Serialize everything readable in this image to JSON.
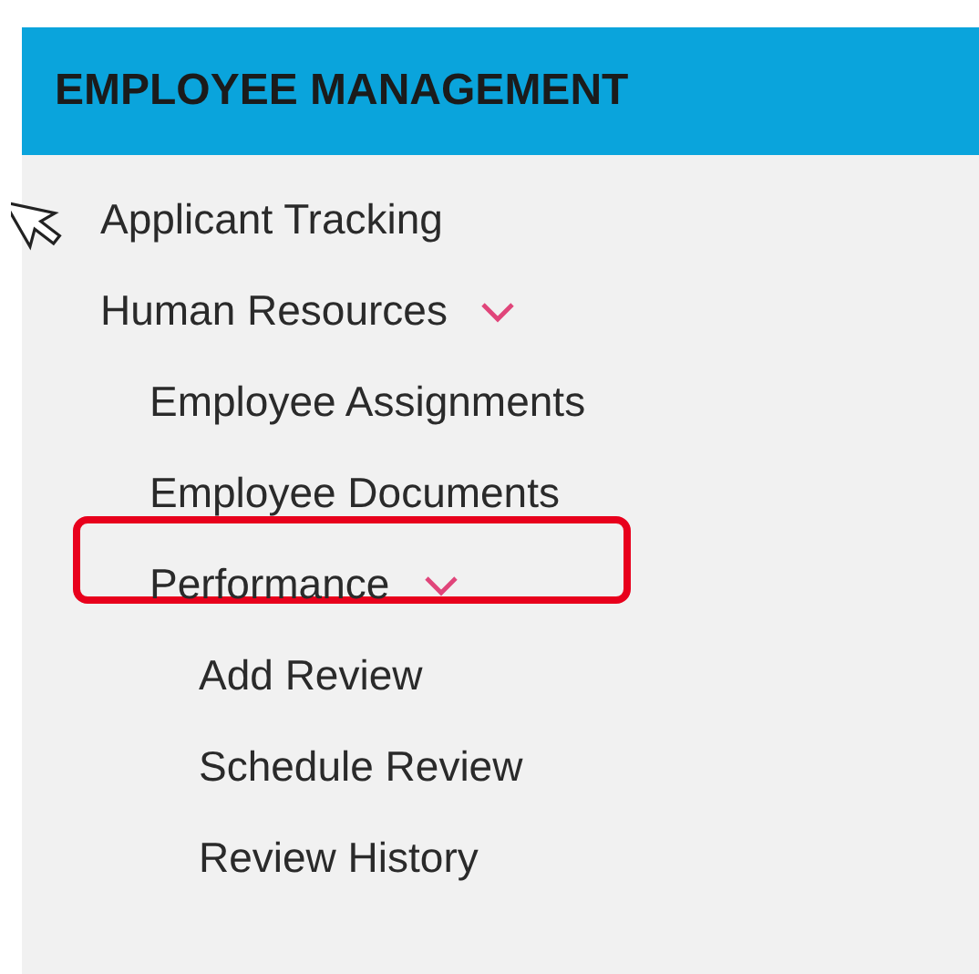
{
  "sidebar": {
    "title": "EMPLOYEE MANAGEMENT",
    "items": [
      {
        "label": "Applicant Tracking",
        "highlighted": false
      },
      {
        "label": "Human Resources",
        "expanded": true,
        "highlighted": false,
        "children": [
          {
            "label": "Employee Assignments",
            "highlighted": false
          },
          {
            "label": "Employee Documents",
            "highlighted": false
          },
          {
            "label": "Performance",
            "expanded": true,
            "highlighted": true,
            "children": [
              {
                "label": "Add Review",
                "highlighted": false
              },
              {
                "label": "Schedule Review",
                "highlighted": false
              },
              {
                "label": "Review History",
                "highlighted": false
              }
            ]
          }
        ]
      }
    ]
  }
}
